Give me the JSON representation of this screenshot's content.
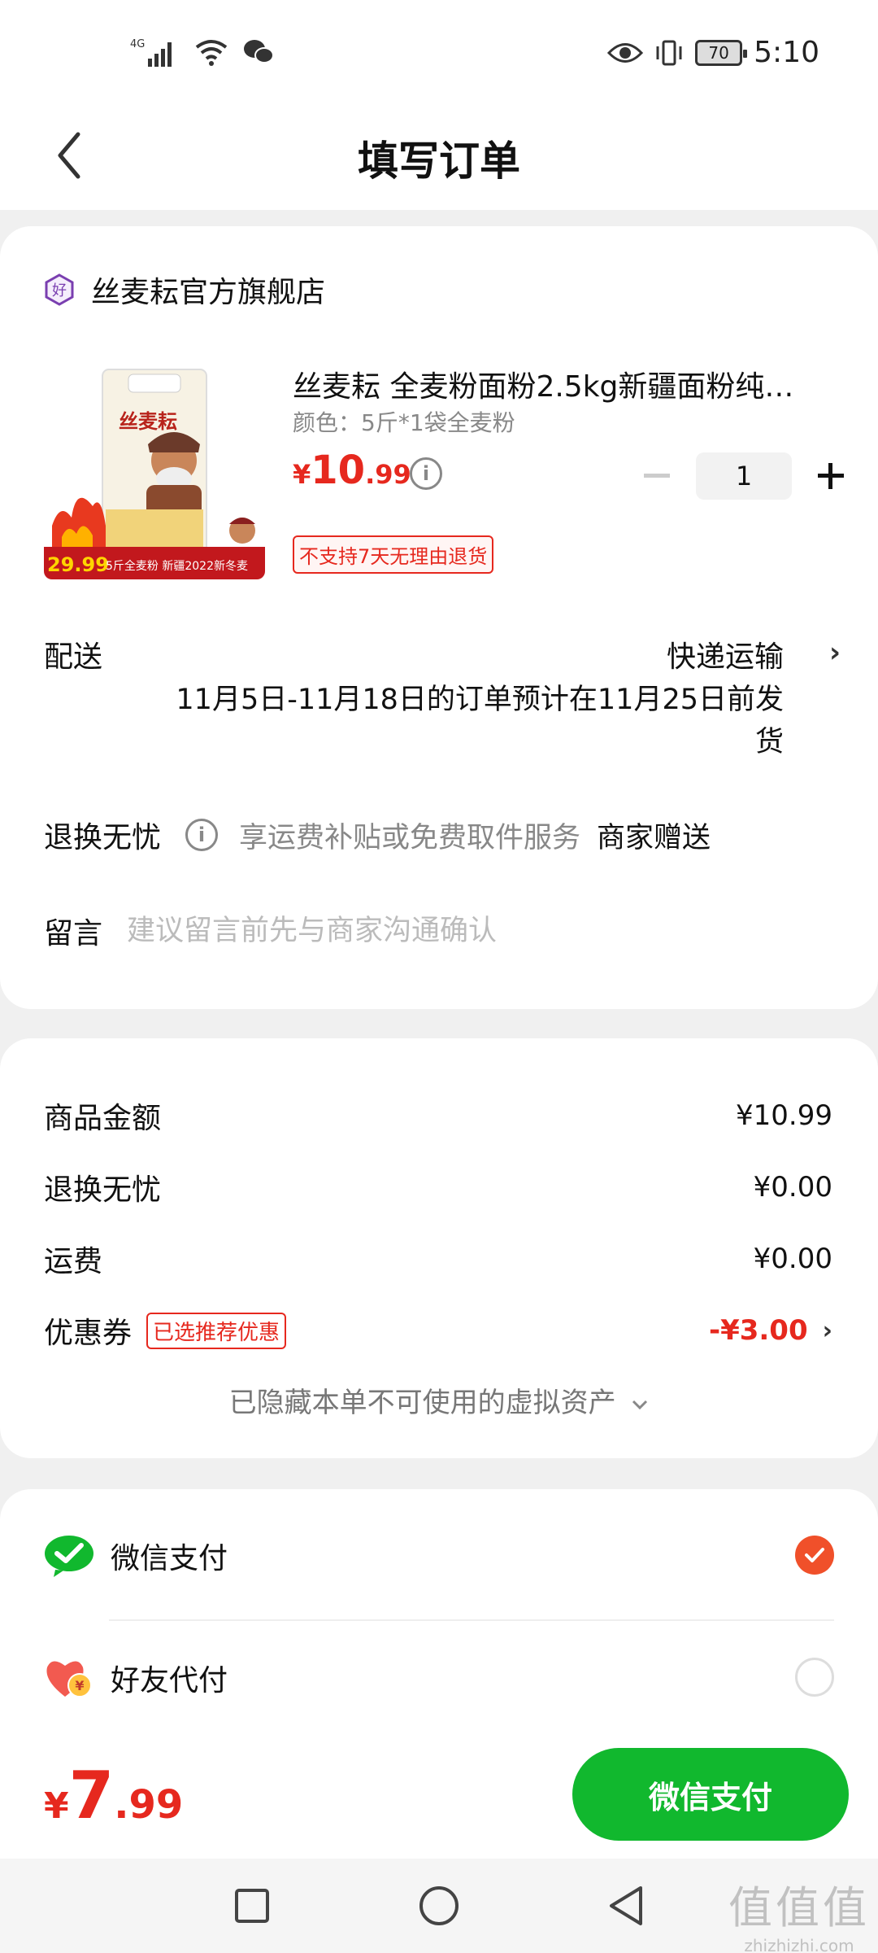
{
  "status_bar": {
    "network": "4G",
    "time": "5:10",
    "battery": "70"
  },
  "header": {
    "title": "填写订单"
  },
  "shop": {
    "name": "丝麦耘官方旗舰店",
    "badge_char": "好"
  },
  "product": {
    "title": "丝麦耘 全麦粉面粉2.5kg新疆面粉纯…",
    "spec": "颜色：5斤*1袋全麦粉",
    "price_symbol": "¥",
    "price_int": "10",
    "price_dec": ".99",
    "quantity": "1",
    "return_tag": "不支持7天无理由退货",
    "image_caption_price": "29.99",
    "image_caption_text": "5斤全麦粉 新疆2022新冬麦",
    "image_brand": "丝麦耘"
  },
  "delivery": {
    "label": "配送",
    "method": "快递运输",
    "note": "11月5日-11月18日的订单预计在11月25日前发货"
  },
  "return_worry": {
    "label": "退换无忧",
    "desc": "享运费补贴或免费取件服务",
    "gift": "商家赠送"
  },
  "message": {
    "label": "留言",
    "placeholder": "建议留言前先与商家沟通确认"
  },
  "fees": {
    "goods_label": "商品金额",
    "goods_value": "¥10.99",
    "worry_label": "退换无忧",
    "worry_value": "¥0.00",
    "shipping_label": "运费",
    "shipping_value": "¥0.00",
    "coupon_label": "优惠券",
    "coupon_tag": "已选推荐优惠",
    "coupon_value": "-¥3.00",
    "hidden_assets": "已隐藏本单不可使用的虚拟资产"
  },
  "payment": {
    "wechat_label": "微信支付",
    "friend_label": "好友代付",
    "selected": "wechat"
  },
  "bottom": {
    "total_symbol": "¥",
    "total_int": "7",
    "total_dec": ".99",
    "pay_button": "微信支付"
  },
  "watermark": {
    "text": "值值值",
    "domain": "zhizhizhi.com"
  },
  "colors": {
    "accent_red": "#e6281e",
    "wechat_green": "#11b82e",
    "radio_orange": "#f0502a"
  }
}
